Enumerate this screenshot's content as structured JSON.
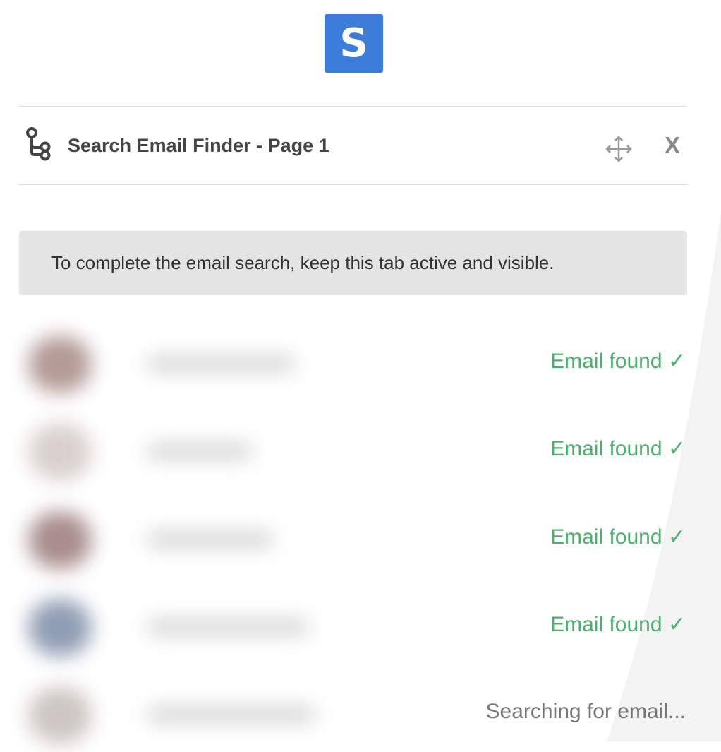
{
  "logo": {
    "letter": "S",
    "color": "#3b7dd8"
  },
  "header": {
    "icon": "route-icon",
    "title": "Search Email Finder - Page 1",
    "move_icon": "move-icon",
    "close_label": "X"
  },
  "notice": {
    "text": "To complete the email search, keep this tab active and visible."
  },
  "results": [
    {
      "status": "Email found ✓",
      "state": "found",
      "avatar_color": "#b39a96"
    },
    {
      "status": "Email found ✓",
      "state": "found",
      "avatar_color": "#d8d0cc"
    },
    {
      "status": "Email found ✓",
      "state": "found",
      "avatar_color": "#a88d8c"
    },
    {
      "status": "Email found ✓",
      "state": "found",
      "avatar_color": "#8f9db3"
    },
    {
      "status": "Searching for email...",
      "state": "searching",
      "avatar_color": "#cdc6c2"
    }
  ],
  "colors": {
    "found": "#4caf6e",
    "searching": "#777777",
    "notice_bg": "#e4e4e4"
  }
}
